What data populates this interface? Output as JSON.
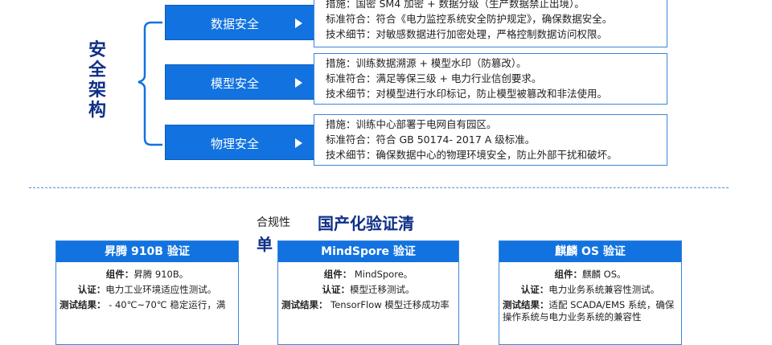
{
  "side_label": [
    "安",
    "全",
    "架",
    "构"
  ],
  "layers": [
    {
      "label": "数据安全",
      "lines": [
        "措施：国密 SM4 加密 + 数据分级（生产数据禁止出境）。",
        "标准符合：符合《电力监控系统安全防护规定》，确保数据安全。",
        "技术细节：对敏感数据进行加密处理，严格控制数据访问权限。"
      ]
    },
    {
      "label": "模型安全",
      "lines": [
        "措施：训练数据溯源 + 模型水印（防篡改）。",
        "标准符合：满足等保三级 + 电力行业信创要求。",
        "技术细节：对模型进行水印标记，防止模型被篡改和非法使用。"
      ]
    },
    {
      "label": "物理安全",
      "lines": [
        "措施：训练中心部署于电网自有园区。",
        "标准符合：符合 GB 50174- 2017 A 级标准。",
        "技术细节：确保数据中心的物理环境安全，防止外部干扰和破坏。"
      ]
    }
  ],
  "compliance": {
    "small_title": "合规性",
    "big_title": "国产化验证清",
    "big_title_wrap": "单"
  },
  "cards": [
    {
      "title": "昇腾 910B 验证",
      "rows": [
        {
          "k": "组件：",
          "v": "昇腾 910B。"
        },
        {
          "k": "认证：",
          "v": "电力工业环境适应性测试。"
        },
        {
          "k": "测试结果：",
          "v": " - 40℃~70℃ 稳定运行，满"
        }
      ]
    },
    {
      "title": "MindSpore 验证",
      "rows": [
        {
          "k": "组件：",
          "v": " MindSpore。"
        },
        {
          "k": "认证：",
          "v": "模型迁移测试。"
        },
        {
          "k": "测试结果：",
          "v": " TensorFlow 模型迁移成功率"
        }
      ]
    },
    {
      "title": "麒麟 OS 验证",
      "rows": [
        {
          "k": "组件：",
          "v": "麒麟 OS。"
        },
        {
          "k": "认证：",
          "v": "电力业务系统兼容性测试。"
        },
        {
          "k": "测试结果：",
          "v": "适配 SCADA/EMS 系统，确保操作系统与电力业务系统的兼容性"
        }
      ]
    }
  ]
}
